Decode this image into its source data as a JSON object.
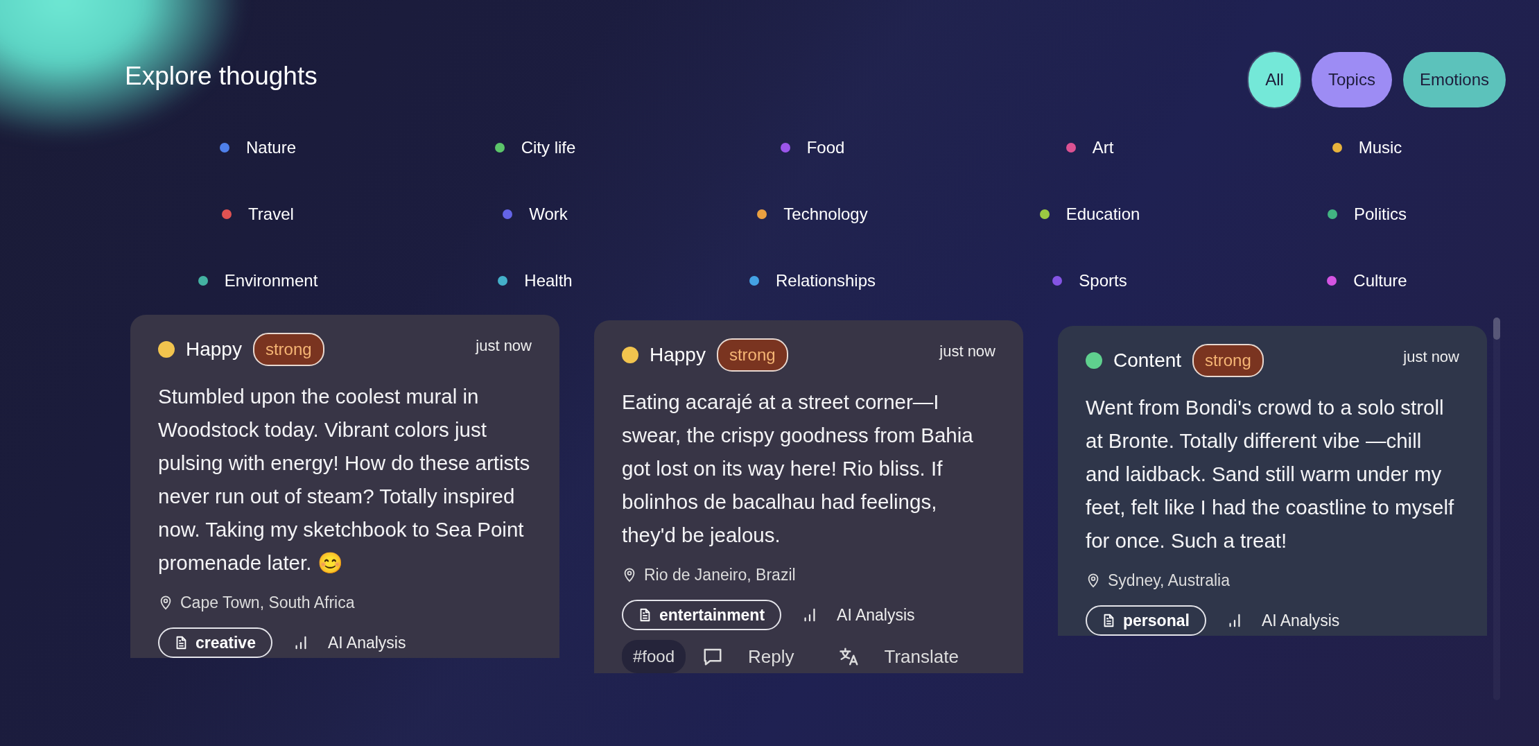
{
  "title": "Explore thoughts",
  "filters": [
    {
      "label": "All",
      "selected": true,
      "color": "#74e8d8"
    },
    {
      "label": "Topics",
      "selected": false,
      "color": "#9d8cf4"
    },
    {
      "label": "Emotions",
      "selected": false,
      "color": "#5cc2bb"
    }
  ],
  "topics": [
    {
      "label": "Nature",
      "color": "#4f80ea"
    },
    {
      "label": "City life",
      "color": "#5cc56a"
    },
    {
      "label": "Food",
      "color": "#9b56ea"
    },
    {
      "label": "Art",
      "color": "#dc5292"
    },
    {
      "label": "Music",
      "color": "#e8b33c"
    },
    {
      "label": "Travel",
      "color": "#e05252"
    },
    {
      "label": "Work",
      "color": "#6464e6"
    },
    {
      "label": "Technology",
      "color": "#eaa040"
    },
    {
      "label": "Education",
      "color": "#9cca42"
    },
    {
      "label": "Politics",
      "color": "#42b482"
    },
    {
      "label": "Environment",
      "color": "#44b2a2"
    },
    {
      "label": "Health",
      "color": "#44b0ca"
    },
    {
      "label": "Relationships",
      "color": "#44a2e4"
    },
    {
      "label": "Sports",
      "color": "#8454e4"
    },
    {
      "label": "Culture",
      "color": "#d454e2"
    }
  ],
  "thoughts": [
    {
      "emotion": "Happy",
      "color": "#f2c44e",
      "intensity": "strong",
      "time": "just now",
      "text": "Stumbled upon the coolest mural in Woodstock today. Vibrant colors just pulsing with energy! How do these artists never run out of steam? Totally inspired now. Taking my sketchbook to Sea Point promenade later. 😊",
      "location": "Cape Town, South Africa",
      "category": "creative",
      "analysis": "AI Analysis"
    },
    {
      "emotion": "Happy",
      "color": "#f2c44e",
      "intensity": "strong",
      "time": "just now",
      "text": "Eating acarajé at a street corner—I swear, the crispy goodness from Bahia got lost on its way here! Rio bliss. If bolinhos de bacalhau had feelings, they'd be jealous.",
      "location": "Rio de Janeiro, Brazil",
      "category": "entertainment",
      "analysis": "AI Analysis",
      "hashtag": "#food",
      "actions": [
        {
          "kind": "reply",
          "label": "Reply"
        },
        {
          "kind": "translate",
          "label": "Translate"
        }
      ]
    },
    {
      "emotion": "Content",
      "color": "#5fd08e",
      "intensity": "strong",
      "time": "just now",
      "text": "Went from Bondi's crowd to a solo stroll at Bronte. Totally different vibe —chill and laidback. Sand still warm under my feet, felt like I had the coastline to myself for once. Such a treat!",
      "location": "Sydney, Australia",
      "category": "personal",
      "analysis": "AI Analysis"
    }
  ]
}
